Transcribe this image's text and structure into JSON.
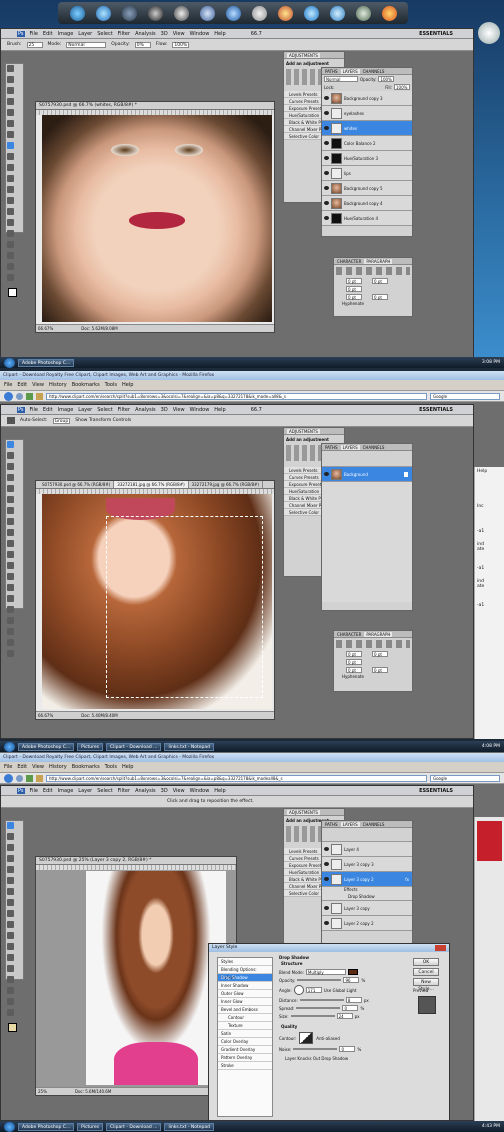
{
  "colors": {
    "accent": "#3a86e0",
    "taskbar": "#1a2a3c",
    "ps_bg": "#777777",
    "shadow_color": "#5a2a12",
    "pink_top": "#e33f8f"
  },
  "shot1": {
    "dock_icons": [
      "mail-icon",
      "globe-icon",
      "camera-icon",
      "media-icon",
      "film-icon",
      "shield-icon",
      "help-icon",
      "trash-icon",
      "paint-icon",
      "ie-icon",
      "network-icon",
      "recycle-icon",
      "firefox-icon"
    ],
    "ps_menu": [
      "File",
      "Edit",
      "Image",
      "Layer",
      "Select",
      "Filter",
      "Analysis",
      "3D",
      "View",
      "Window",
      "Help"
    ],
    "ps_zoom": "66.7",
    "essentials": "ESSENTIALS",
    "options": {
      "brush": "Brush:",
      "brush_size": "25",
      "mode_label": "Mode:",
      "mode": "Normal",
      "opacity_label": "Opacity:",
      "opacity": "0%",
      "flow_label": "Flow:",
      "flow": "100%"
    },
    "doc_title": "S0757930.psd @ 66.7% (whites, RGB/8#) *",
    "doc_zoom": "66.67%",
    "doc_info": "Doc: 5.62M/8.08M",
    "adjust_title": "ADJUSTMENTS",
    "adjust_add": "Add an adjustment",
    "adjust_presets": [
      "Levels Presets",
      "Curves Presets",
      "Exposure Presets",
      "Hue/Saturation",
      "Black & White Pr",
      "Channel Mixer P",
      "Selective Color"
    ],
    "layers_tabs": [
      "PATHS",
      "LAYERS",
      "CHANNELS"
    ],
    "blend": "Normal",
    "opacity_label": "Opacity:",
    "opacity": "100%",
    "lock_label": "Lock:",
    "fill_label": "Fill:",
    "fill": "100%",
    "layers": [
      "Background copy 3",
      "eyelashes",
      "whites",
      "Color Balance 2",
      "Hue/Saturation 3",
      "lips",
      "Background copy 5",
      "Background copy 4",
      "Hue/Saturation 4"
    ],
    "char_tabs": [
      "CHARACTER",
      "PARAGRAPH"
    ],
    "para_values": [
      "0 pt",
      "0 pt",
      "0 pt",
      "0 pt",
      "0 pt"
    ],
    "hyphenate": "Hyphenate",
    "taskbar_btn": "Adobe Photoshop C...",
    "clock": "3:08 PM"
  },
  "shot2": {
    "ff_title": "Clipart - Download Royalty Free Clipart, Clipart Images, Web Art and Graphics - Mozilla Firefox",
    "ff_menu": [
      "File",
      "Edit",
      "View",
      "History",
      "Bookmarks",
      "Tools",
      "Help"
    ],
    "url": "http://www.clipart.com/en/search/split?sub1=8onrows=3&ocolsi=7&realign=&ia=p8&q=33272178&ik_mode=all8&_s",
    "search": "Google",
    "ps_menu": [
      "File",
      "Edit",
      "Image",
      "Layer",
      "Select",
      "Filter",
      "Analysis",
      "3D",
      "View",
      "Window",
      "Help"
    ],
    "ps_zoom": "66.7",
    "essentials": "ESSENTIALS",
    "options": {
      "autoselect": "Auto-Select:",
      "group": "Group",
      "transform": "Show Transform Controls"
    },
    "doc_tabs": [
      "S0757930.psd @ 66.7% (RGB/8#)",
      "33272181.jpg @ 66.7% (RGB/8#)",
      "33272179.jpg @ 66.7% (RGB/8#)"
    ],
    "doc_title": "33272181.jpg @ 66.7% (RGB/8#) *",
    "doc_zoom": "66.67%",
    "doc_info": "Doc: 5.40M/8.40M",
    "adjust_title": "ADJUSTMENTS",
    "adjust_add": "Add an adjustment",
    "adjust_presets": [
      "Levels Presets",
      "Curves Presets",
      "Exposure Presets",
      "Hue/Saturation",
      "Black & White Pr",
      "Channel Mixer P",
      "Selective Color"
    ],
    "layers_tabs": [
      "PATHS",
      "LAYERS",
      "CHANNELS"
    ],
    "layers": [
      "Background"
    ],
    "char_tabs": [
      "CHARACTER",
      "PARAGRAPH"
    ],
    "para_values": [
      "0 pt",
      "0 pt",
      "0 pt",
      "0 pt",
      "0 pt"
    ],
    "hyphenate": "Hyphenate",
    "web_side": [
      "Help",
      "Inc",
      "-a1",
      "ind",
      "ate",
      "-a1",
      "ind",
      "ate",
      "-a1"
    ]
  },
  "shot3": {
    "taskbar_top": [
      "Adobe Photoshop C...",
      "Pictures",
      "Clipart - Download ...",
      "links.txt - Notepad"
    ],
    "clock_top": "4:08 PM",
    "ff_title": "Clipart - Download Royalty Free Clipart, Clipart Images, Web Art and Graphics - Mozilla Firefox",
    "ff_menu": [
      "File",
      "Edit",
      "View",
      "History",
      "Bookmarks",
      "Tools",
      "Help"
    ],
    "url": "http://www.clipart.com/en/search/split?sub1=8onrows=3&ocolsi=7&realign=&ia=p8&q=33272178&ik_modeall8&_s",
    "search": "Google",
    "ps_menu": [
      "File",
      "Edit",
      "Image",
      "Layer",
      "Select",
      "Filter",
      "Analysis",
      "3D",
      "View",
      "Window",
      "Help"
    ],
    "hint": "Click and drag to reposition the effect.",
    "essentials": "ESSENTIALS",
    "doc_title": "S0757930.psd @ 25% (Layer 3 copy 2, RGB/8#) *",
    "doc_zoom": "25%",
    "doc_info": "Doc: 5.6M/140.6M",
    "adjust_title": "ADJUSTMENTS",
    "adjust_add": "Add an adjustment",
    "adjust_presets": [
      "Levels Presets",
      "Curves Presets",
      "Exposure Presets",
      "Hue/Saturation",
      "Black & White Pr",
      "Channel Mixer P",
      "Selective Color"
    ],
    "layers_tabs": [
      "PATHS",
      "LAYERS",
      "CHANNELS"
    ],
    "layers": [
      "Layer 4",
      "Layer 3 copy 3",
      "Layer 3 copy 2",
      "Effects",
      "Drop Shadow",
      "Layer 3 copy",
      "Layer 2 copy 2"
    ],
    "dialog": {
      "title": "Layer Style",
      "styles_header": "Styles",
      "styles": [
        "Blending Options: Default",
        "Drop Shadow",
        "Inner Shadow",
        "Outer Glow",
        "Inner Glow",
        "Bevel and Emboss",
        "Contour",
        "Texture",
        "Satin",
        "Color Overlay",
        "Gradient Overlay",
        "Pattern Overlay",
        "Stroke"
      ],
      "section": "Drop Shadow",
      "structure": "Structure",
      "blend_mode_label": "Blend Mode:",
      "blend_mode": "Multiply",
      "opacity_label": "Opacity:",
      "opacity": "96",
      "angle_label": "Angle:",
      "angle": "171",
      "global_light": "Use Global Light",
      "distance_label": "Distance:",
      "distance": "8",
      "spread_label": "Spread:",
      "spread": "0",
      "size_label": "Size:",
      "size": "24",
      "px": "px",
      "pct": "%",
      "quality": "Quality",
      "contour_label": "Contour:",
      "antialiased": "Anti-aliased",
      "noise_label": "Noise:",
      "noise": "0",
      "knockout": "Layer Knocks Out Drop Shadow",
      "ok": "OK",
      "cancel": "Cancel",
      "new_style": "New Style...",
      "preview": "Preview"
    },
    "taskbar_bottom": [
      "Adobe Photoshop C...",
      "Pictures",
      "Clipart - Download ...",
      "links.txt - Notepad"
    ],
    "clock_bottom": "4:43 PM"
  }
}
